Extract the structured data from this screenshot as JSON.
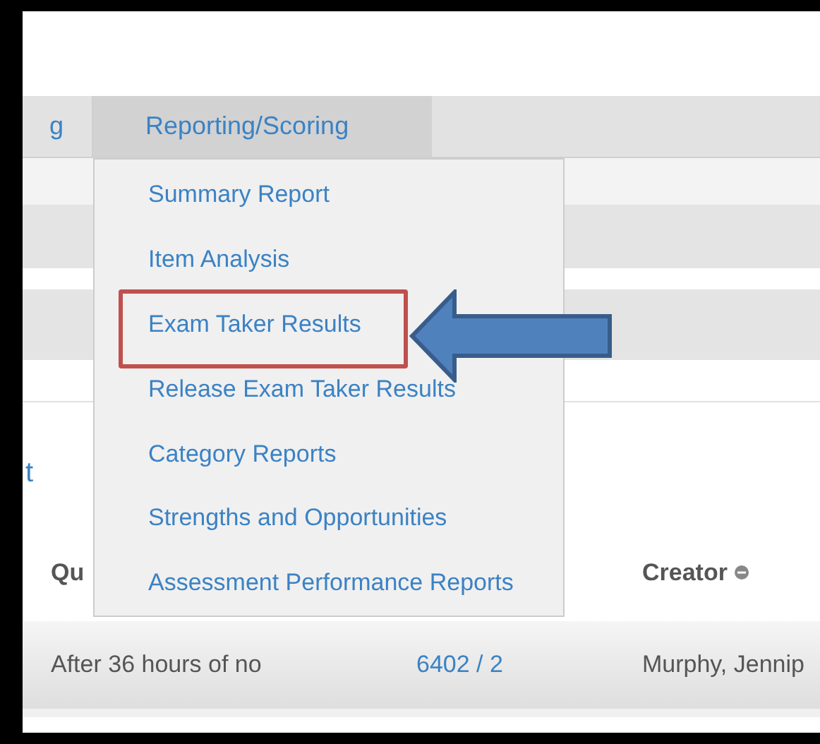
{
  "nav_tabs": [
    {
      "label": "g",
      "selected": false
    },
    {
      "label": "Reporting/Scoring",
      "selected": true
    }
  ],
  "dropdown_menu": {
    "items": [
      {
        "label": "Summary Report",
        "highlighted": false
      },
      {
        "label": "Item Analysis",
        "highlighted": false
      },
      {
        "label": "Exam Taker Results",
        "highlighted": true
      },
      {
        "label": "Release Exam Taker Results",
        "highlighted": false
      },
      {
        "label": "Category Reports",
        "highlighted": false
      },
      {
        "label": "Strengths and Opportunities",
        "highlighted": false
      },
      {
        "label": "Assessment Performance Reports",
        "highlighted": false
      }
    ]
  },
  "partial_heading": "t",
  "table": {
    "columns": [
      {
        "label": "Qu",
        "sortable": false
      },
      {
        "label": "Creator",
        "sortable": true
      }
    ],
    "rows": [
      {
        "column_1": "After 36 hours of no",
        "column_2": "6402 / 2",
        "creator": "Murphy, Jennip"
      }
    ]
  }
}
